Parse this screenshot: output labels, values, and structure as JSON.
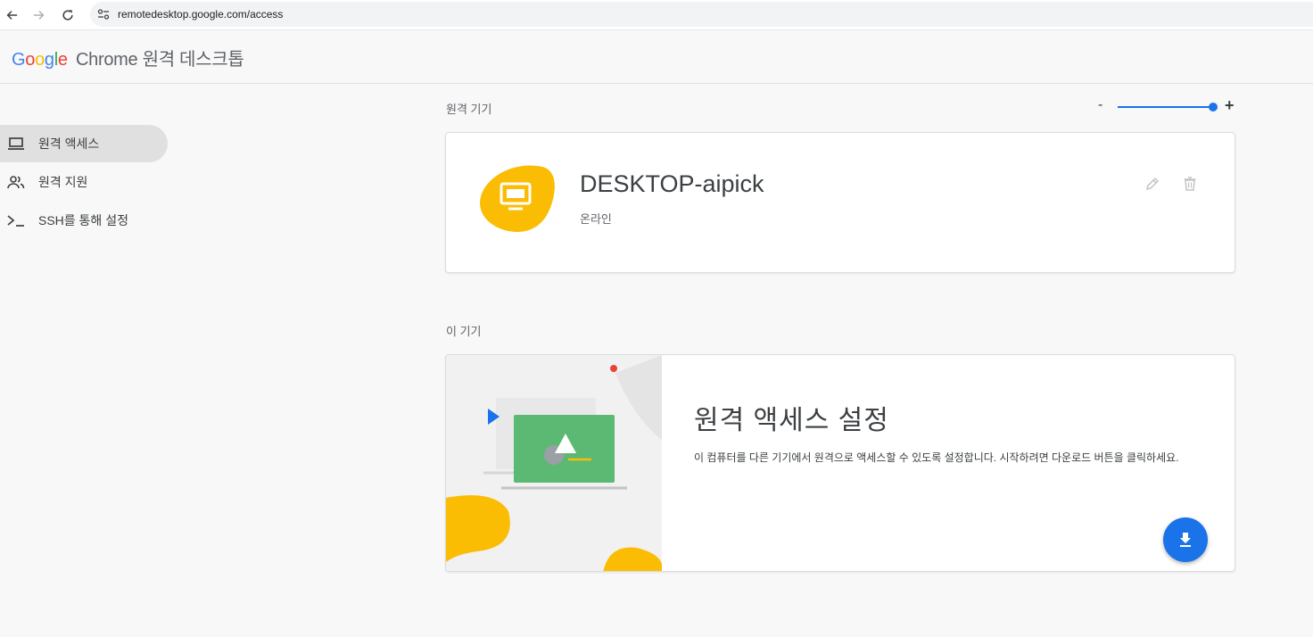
{
  "browser": {
    "url": "remotedesktop.google.com/access",
    "back_icon": "arrow-left-icon",
    "forward_icon": "arrow-right-icon",
    "reload_icon": "reload-icon"
  },
  "header": {
    "logo_letters": [
      "G",
      "o",
      "o",
      "g",
      "l",
      "e"
    ],
    "app_name": "Chrome 원격 데스크톱"
  },
  "sidebar": {
    "items": [
      {
        "label": "원격 액세스",
        "icon": "laptop-icon",
        "active": true
      },
      {
        "label": "원격 지원",
        "icon": "people-icon",
        "active": false
      },
      {
        "label": "SSH를 통해 설정",
        "icon": "terminal-icon",
        "active": false
      }
    ]
  },
  "remote_devices": {
    "title": "원격 기기",
    "zoom_minus": "-",
    "zoom_plus": "+",
    "zoom_level": 1.0,
    "device": {
      "name": "DESKTOP-aipick",
      "status": "온라인",
      "icon": "monitor-icon",
      "edit_icon": "pencil-icon",
      "delete_icon": "trash-icon"
    }
  },
  "this_device": {
    "title": "이 기기",
    "setup_title": "원격 액세스 설정",
    "setup_desc": "이 컴퓨터를 다른 기기에서 원격으로 액세스할 수 있도록 설정합니다. 시작하려면 다운로드 버튼을 클릭하세요.",
    "download_icon": "download-icon"
  },
  "colors": {
    "accent": "#1a73e8",
    "device_blob": "#fbbc04",
    "illus_screen": "#5bb974",
    "active_nav": "#e0e0e0"
  }
}
